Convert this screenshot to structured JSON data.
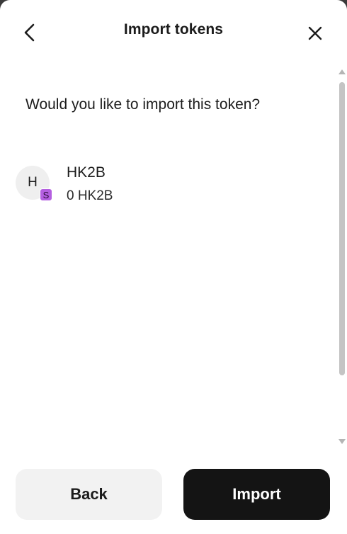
{
  "header": {
    "title": "Import tokens",
    "back_icon": "chevron-left-icon",
    "close_icon": "close-icon"
  },
  "main": {
    "prompt": "Would you like to import this token?",
    "token": {
      "avatar_letter": "H",
      "chain_badge": "S",
      "symbol": "HK2B",
      "balance": "0 HK2B"
    }
  },
  "footer": {
    "back_label": "Back",
    "import_label": "Import"
  },
  "colors": {
    "chain_badge": "#b45fe0",
    "primary_button": "#141414",
    "secondary_button": "#f2f2f2"
  }
}
